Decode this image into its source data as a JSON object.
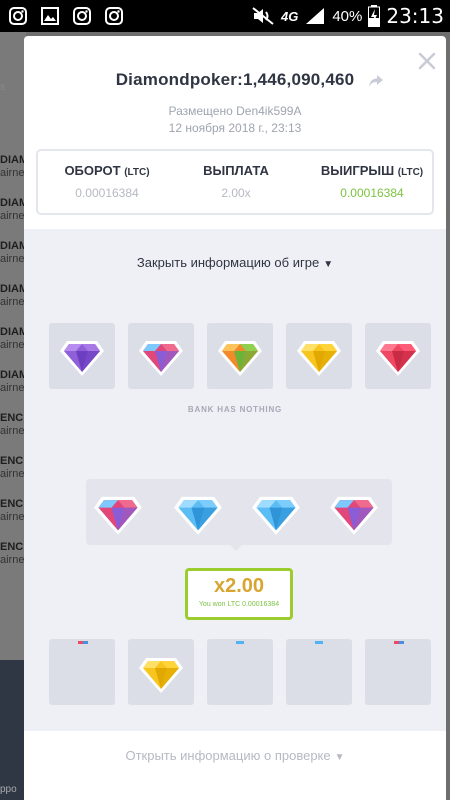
{
  "status_bar": {
    "battery_percent": "40%",
    "time": "23:13",
    "network": "4G",
    "left_icons": [
      "instagram-icon",
      "gallery-icon",
      "instagram-icon",
      "instagram-icon"
    ]
  },
  "background": {
    "tab_fragment": "s",
    "rows": [
      {
        "bold": "DIAM",
        "name": "airne"
      },
      {
        "bold": "DIAM",
        "name": "airne"
      },
      {
        "bold": "DIAM",
        "name": "airne"
      },
      {
        "bold": "DIAM",
        "name": "airne"
      },
      {
        "bold": "DIAM",
        "name": "airne"
      },
      {
        "bold": "DIAM",
        "name": "airne"
      },
      {
        "bold": "ENC",
        "name": "airne"
      },
      {
        "bold": "ENC",
        "name": "airne"
      },
      {
        "bold": "ENC",
        "name": "airne"
      },
      {
        "bold": "ENC",
        "name": "airne"
      }
    ],
    "bottom_fragment": "ppo"
  },
  "modal": {
    "title": "Diamondpoker:1,446,090,460",
    "placed_prefix": "Размещено ",
    "placed_user": "Den4ik599A",
    "date": "12 ноября 2018 г., 23:13",
    "stats": [
      {
        "label": "ОБОРОТ",
        "unit": "(LTC)",
        "value": "0.00016384"
      },
      {
        "label": "ВЫПЛАТА",
        "unit": "",
        "value": "2.00x"
      },
      {
        "label": "ВЫИГРЫШ",
        "unit": "(LTC)",
        "value": "0.00016384"
      }
    ],
    "toggle_game_info": "Закрыть информацию об игре",
    "bank_status": "BANK HAS NOTHING",
    "multiplier": "x2.00",
    "win_message": "You won LTC 0.00016384",
    "toggle_verify_info": "Открыть информацию о проверке"
  },
  "bank_gems": [
    "purple",
    "multi-blue",
    "orange-green",
    "yellow",
    "red"
  ],
  "hand_gems": [
    "multi-blue",
    "blue",
    "blue",
    "multi-blue"
  ],
  "player_slots": [
    "empty",
    "yellow",
    "empty",
    "empty",
    "empty"
  ],
  "colors": {
    "accent_green": "#7cc342",
    "multiplier_gold": "#d8a531",
    "border_lime": "#9ccc2d",
    "text_dark": "#2f3542",
    "text_muted": "#b6b9c3"
  }
}
